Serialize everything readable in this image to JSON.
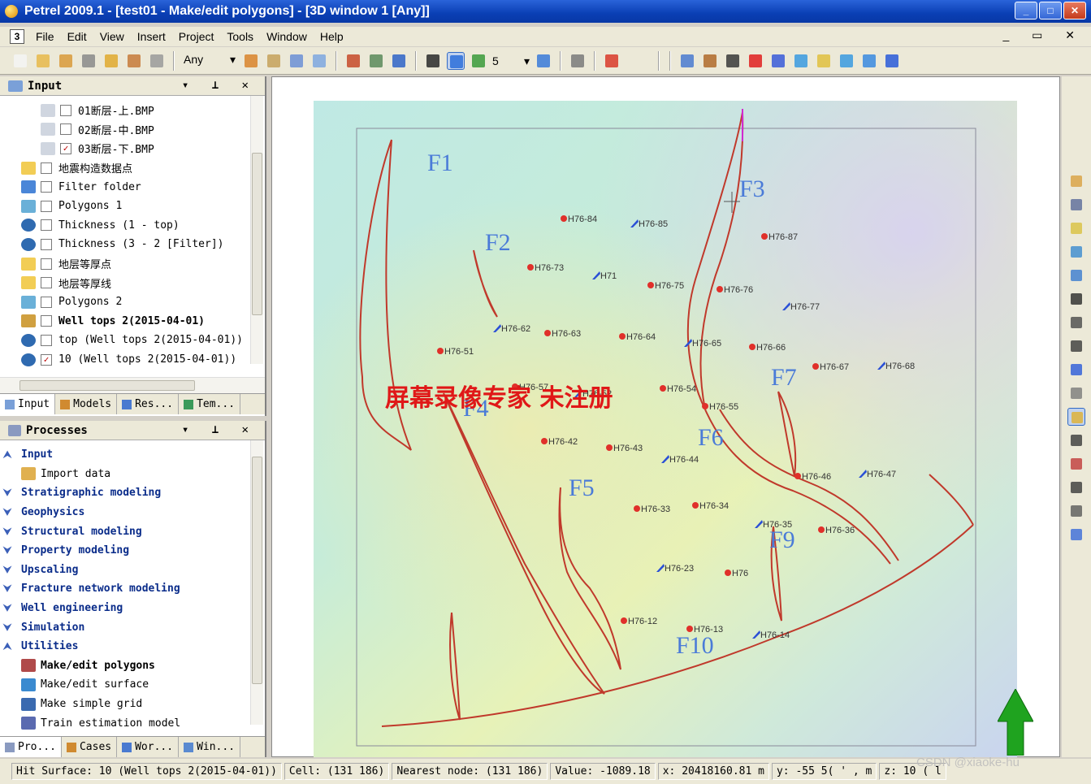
{
  "window": {
    "title": "Petrel 2009.1 - [test01 - Make/edit polygons] - [3D window 1 [Any]]"
  },
  "menu": {
    "items": [
      "File",
      "Edit",
      "View",
      "Insert",
      "Project",
      "Tools",
      "Window",
      "Help"
    ],
    "mdi_icon": "3"
  },
  "toolbar": {
    "filter_value": "Any",
    "count_value": "5"
  },
  "input_panel": {
    "title": "Input",
    "items": [
      {
        "label": "01断层-上.BMP",
        "checked": false,
        "icon": "image-icon"
      },
      {
        "label": "02断层-中.BMP",
        "checked": false,
        "icon": "image-icon"
      },
      {
        "label": "03断层-下.BMP",
        "checked": true,
        "icon": "image-icon"
      },
      {
        "label": "地震构造数据点",
        "checked": false,
        "icon": "folder-icon"
      },
      {
        "label": "Filter folder",
        "checked": false,
        "icon": "filter-folder-icon"
      },
      {
        "label": "Polygons 1",
        "checked": false,
        "icon": "polygons-icon"
      },
      {
        "label": "Thickness (1 - top)",
        "checked": false,
        "icon": "surface-icon"
      },
      {
        "label": "Thickness (3 - 2 [Filter])",
        "checked": false,
        "icon": "surface-icon"
      },
      {
        "label": "地层等厚点",
        "checked": false,
        "icon": "folder-icon"
      },
      {
        "label": "地层等厚线",
        "checked": false,
        "icon": "folder-icon"
      },
      {
        "label": "Polygons 2",
        "checked": false,
        "icon": "polygons-icon"
      },
      {
        "label": "Well tops 2(2015-04-01)",
        "checked": false,
        "icon": "well-tops-icon"
      },
      {
        "label": "top (Well tops 2(2015-04-01))",
        "checked": false,
        "icon": "surface-icon"
      },
      {
        "label": "10 (Well tops 2(2015-04-01))",
        "checked": true,
        "icon": "surface-icon"
      }
    ],
    "tabs": [
      "Input",
      "Models",
      "Res...",
      "Tem..."
    ]
  },
  "processes_panel": {
    "title": "Processes",
    "items": [
      {
        "label": "Input",
        "type": "group",
        "expanded": true
      },
      {
        "label": "Import data",
        "type": "item"
      },
      {
        "label": "Stratigraphic modeling",
        "type": "group"
      },
      {
        "label": "Geophysics",
        "type": "group"
      },
      {
        "label": "Structural modeling",
        "type": "group"
      },
      {
        "label": "Property modeling",
        "type": "group"
      },
      {
        "label": "Upscaling",
        "type": "group"
      },
      {
        "label": "Fracture network modeling",
        "type": "group"
      },
      {
        "label": "Well engineering",
        "type": "group"
      },
      {
        "label": "Simulation",
        "type": "group"
      },
      {
        "label": "Utilities",
        "type": "group",
        "expanded": true
      },
      {
        "label": "Make/edit polygons",
        "type": "item",
        "bold": true
      },
      {
        "label": "Make/edit surface",
        "type": "item"
      },
      {
        "label": "Make simple grid",
        "type": "item"
      },
      {
        "label": "Train estimation model",
        "type": "item"
      }
    ],
    "tabs": [
      "Pro...",
      "Cases",
      "Wor...",
      "Win..."
    ]
  },
  "map": {
    "fault_labels": [
      "F1",
      "F2",
      "F3",
      "F4",
      "F5",
      "F6",
      "F7",
      "F9",
      "F10"
    ],
    "wells_red": [
      "H76-84",
      "H76-87",
      "H76-73",
      "H76-75",
      "H76-76",
      "H76-63",
      "H76-64",
      "H76-66",
      "H76-51",
      "H76-67",
      "H76-57",
      "H76-55",
      "H76-42",
      "H76-43",
      "H76-46",
      "H76-33",
      "H76-34",
      "H76-36",
      "H76",
      "H76-12",
      "H76-13",
      "H76-54"
    ],
    "wells_blue": [
      "H76-85",
      "H71",
      "H76-77",
      "H76-62",
      "H76-65",
      "H76-68",
      "H76-44",
      "H76-47",
      "H76-35",
      "H76-23",
      "H76-14",
      "H76-52"
    ],
    "overlay_text": "屏幕录像专家 未注册"
  },
  "status": {
    "hit_surface": "Hit Surface: 10 (Well tops 2(2015-04-01))",
    "cell": "Cell: (131 186)",
    "nearest": "Nearest node: (131 186)",
    "value": "Value: -1089.18",
    "x": "x: 20418160.81 m",
    "y": "y: -55 5( ' ,  m",
    "z": "z: 10 ( l"
  },
  "watermark": "CSDN @xiaoke-hu",
  "colors": {
    "titlebar": "#0a3fb4",
    "fault": "#c0392b",
    "well_red": "#e0302a",
    "well_blue": "#2a4fd6",
    "fault_label": "#4a7bd8",
    "overlay_text": "#e01818",
    "arrow": "#1fa31f"
  }
}
